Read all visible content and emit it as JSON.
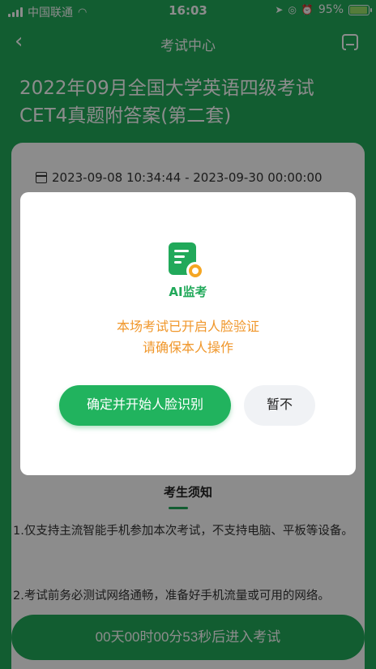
{
  "status_bar": {
    "carrier": "中国联通",
    "time": "16:03",
    "battery": "95%",
    "battery_level": 0.95
  },
  "nav": {
    "title": "考试中心"
  },
  "exam": {
    "title_line1": "2022年09月全国大学英语四级考试",
    "title_line2": "CET4真题附答案(第二套)",
    "time_range": "2023-09-08 10:34:44 - 2023-09-30 00:00:00"
  },
  "notice": {
    "heading": "考生须知",
    "rules": [
      "1.仅支持主流智能手机参加本次考试，不支持电脑、平板等设备。",
      "2.考试前务必测试网络通畅，准备好手机流量或可用的网络。"
    ]
  },
  "start_button": "00天00时00分53秒后进入考试",
  "modal": {
    "logo_label": "AI监考",
    "message_line1": "本场考试已开启人脸验证",
    "message_line2": "请确保本人操作",
    "confirm_label": "确定并开始人脸识别",
    "later_label": "暂不"
  },
  "colors": {
    "brand_green": "#21a95a",
    "warning_orange": "#f0972b"
  }
}
